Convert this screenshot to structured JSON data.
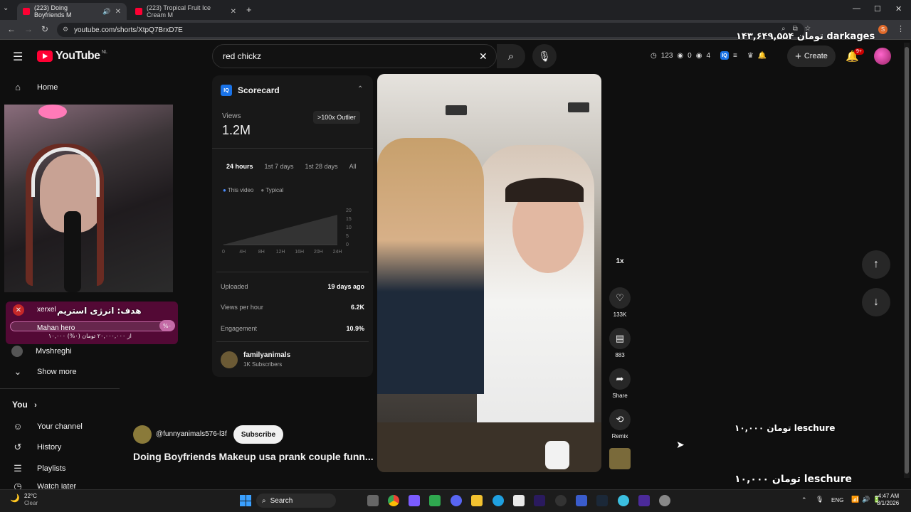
{
  "browser": {
    "tabs": [
      {
        "title": "(223) Doing Boyfriends M",
        "active": true
      },
      {
        "title": "(223) Tropical Fruit Ice Cream M",
        "active": false
      }
    ],
    "new_tab": "+",
    "url": "youtube.com/shorts/XtpQ7BrxD7E",
    "minimize": "—",
    "maximize": "☐",
    "close": "✕"
  },
  "overlay": {
    "top_donation": "۱۴۳,۶۴۹,۵۵۴ تومان darkages",
    "mid_donation": "۱۰,۰۰۰ تومان  leschure",
    "bottom_donation": "۱۰,۰۰۰ تومان  leschure",
    "goal_title": "هدف: انرژی استریم",
    "goal_user1": "xerxel",
    "goal_user2": "Mahan hero",
    "goal_progress_text": "۱۰,۰۰۰ از ۲۰,۰۰۰,۰۰۰ تومان (۰%)",
    "goal_percent": "%۰"
  },
  "youtube": {
    "logo": "YouTube",
    "region": "NL",
    "search_value": "red chickz",
    "stats": {
      "a": "123",
      "b": "0",
      "c": "4"
    },
    "create_label": "Create",
    "notifications": "9+"
  },
  "sidebar": {
    "home": "Home",
    "mvshreghi": "Mvshreghi",
    "show_more": "Show more",
    "you": "You",
    "items": [
      "Your channel",
      "History",
      "Playlists",
      "Watch later"
    ]
  },
  "scorecard": {
    "title": "Scorecard",
    "views_label": "Views",
    "views_value": "1.2M",
    "outlier": ">100x Outlier",
    "tabs": [
      "24 hours",
      "1st 7 days",
      "1st 28 days",
      "All"
    ],
    "legend_this": "This video",
    "legend_typical": "Typical",
    "y_ticks": [
      "20",
      "15",
      "10",
      "5",
      "0"
    ],
    "x_ticks": [
      "0",
      "4H",
      "8H",
      "12H",
      "16H",
      "20H",
      "24H"
    ],
    "uploaded_label": "Uploaded",
    "uploaded_value": "19 days ago",
    "vph_label": "Views per hour",
    "vph_value": "6.2K",
    "eng_label": "Engagement",
    "eng_value": "10.9%",
    "channel_name": "familyanimals",
    "channel_subs": "1K Subscribers"
  },
  "short": {
    "channel_handle": "@funnyanimals576-l3f",
    "subscribe": "Subscribe",
    "title": "Doing Boyfriends Makeup usa prank couple funn...",
    "speed": "1x",
    "likes": "133K",
    "comments": "883",
    "share": "Share",
    "remix": "Remix"
  },
  "taskbar": {
    "temp": "22°C",
    "weather": "Clear",
    "search": "Search",
    "lang": "ENG",
    "time": "4:47 AM",
    "date": "8/1/2026"
  }
}
